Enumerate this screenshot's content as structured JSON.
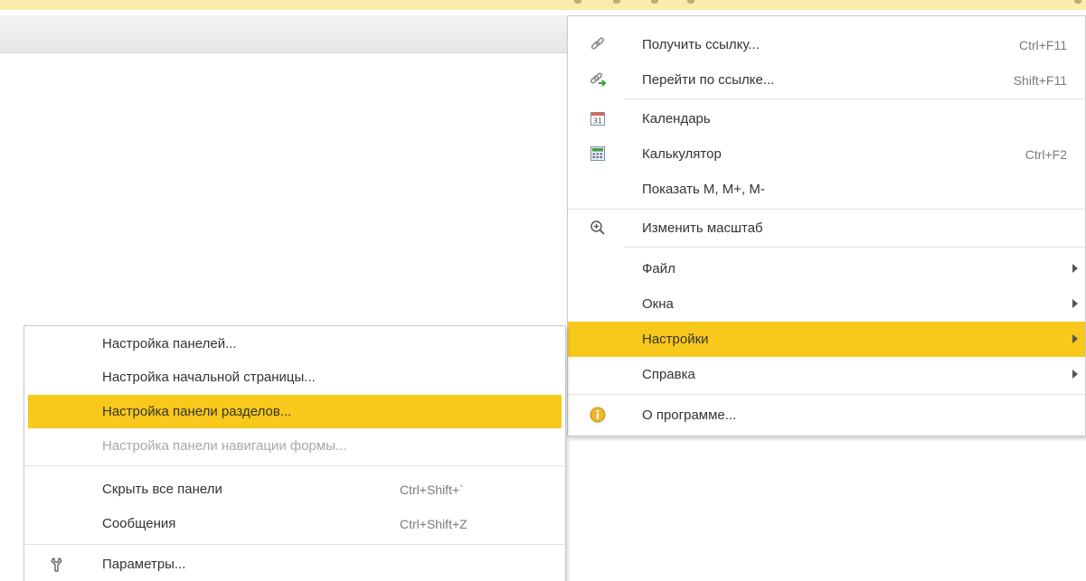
{
  "colors": {
    "highlight": "#f8c91a",
    "text": "#333333",
    "shortcut": "#7b7b7b",
    "disabled": "#a8a8a8",
    "top_strip": "#fbecaa"
  },
  "main_menu": {
    "items": [
      {
        "label": "Получить ссылку...",
        "shortcut": "Ctrl+F11",
        "icon": "link-icon"
      },
      {
        "label": "Перейти по ссылке...",
        "shortcut": "Shift+F11",
        "icon": "follow-link-icon"
      },
      {
        "label": "Календарь",
        "shortcut": "",
        "icon": "calendar-icon"
      },
      {
        "label": "Калькулятор",
        "shortcut": "Ctrl+F2",
        "icon": "calculator-icon"
      },
      {
        "label": "Показать M, M+, M-",
        "shortcut": "",
        "icon": ""
      },
      {
        "label": "Изменить масштаб",
        "shortcut": "",
        "icon": "zoom-icon"
      },
      {
        "label": "Файл",
        "shortcut": "",
        "icon": "",
        "submenu": true
      },
      {
        "label": "Окна",
        "shortcut": "",
        "icon": "",
        "submenu": true
      },
      {
        "label": "Настройки",
        "shortcut": "",
        "icon": "",
        "submenu": true,
        "highlighted": true
      },
      {
        "label": "Справка",
        "shortcut": "",
        "icon": "",
        "submenu": true
      },
      {
        "label": "О программе...",
        "shortcut": "",
        "icon": "info-icon"
      }
    ]
  },
  "settings_submenu": {
    "items": [
      {
        "label": "Настройка панелей...",
        "shortcut": ""
      },
      {
        "label": "Настройка начальной страницы...",
        "shortcut": ""
      },
      {
        "label": "Настройка панели разделов...",
        "shortcut": "",
        "highlighted": true
      },
      {
        "label": "Настройка панели навигации формы...",
        "shortcut": "",
        "disabled": true
      },
      {
        "label": "Скрыть все панели",
        "shortcut": "Ctrl+Shift+`"
      },
      {
        "label": "Сообщения",
        "shortcut": "Ctrl+Shift+Z"
      },
      {
        "label": "Параметры...",
        "shortcut": "",
        "icon": "wrench-icon"
      }
    ]
  }
}
